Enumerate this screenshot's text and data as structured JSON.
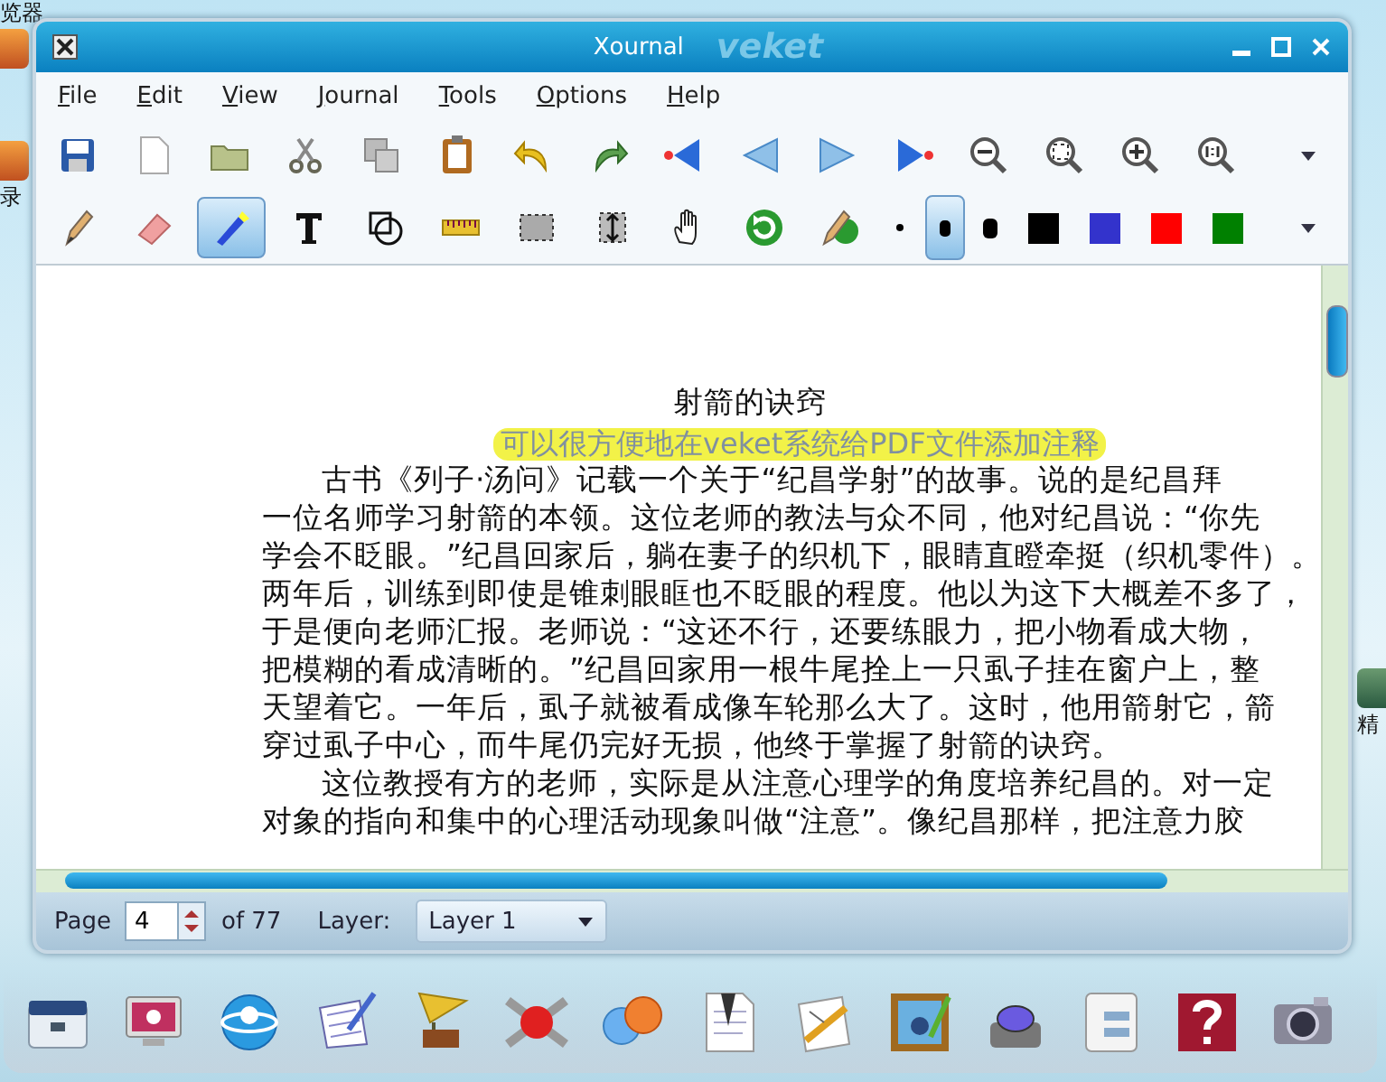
{
  "window": {
    "title": "Xournal",
    "brand": "veket"
  },
  "menu": [
    "File",
    "Edit",
    "View",
    "Journal",
    "Tools",
    "Options",
    "Help"
  ],
  "tools": [
    {
      "kind": "tool",
      "selected": false
    },
    {
      "kind": "tool",
      "selected": false
    },
    {
      "kind": "tool",
      "selected": true
    },
    {
      "kind": "tool",
      "selected": false
    },
    {
      "kind": "tool",
      "selected": false
    },
    {
      "kind": "tool",
      "selected": false
    },
    {
      "kind": "tool",
      "selected": false
    },
    {
      "kind": "tool",
      "selected": false
    },
    {
      "kind": "tool",
      "selected": false
    },
    {
      "kind": "tool",
      "selected": false
    },
    {
      "kind": "tool",
      "selected": false
    },
    {
      "kind": "thickness",
      "selected": false
    },
    {
      "kind": "thickness",
      "selected": true
    },
    {
      "kind": "thickness",
      "selected": false
    },
    {
      "kind": "color",
      "color": "#000000"
    },
    {
      "kind": "color",
      "color": "#3333cc"
    },
    {
      "kind": "color",
      "color": "#ff0000"
    },
    {
      "kind": "color",
      "color": "#008000"
    }
  ],
  "document": {
    "title": "射箭的诀窍",
    "annotation": "可以很方便地在veket系统给PDF文件添加注释",
    "paragraphs": [
      [
        "古书《列子·汤问》记载一个关于“纪昌学射”的故事。说的是纪昌拜",
        "一位名师学习射箭的本领。这位老师的教法与众不同，他对纪昌说：“你先",
        "学会不眨眼。”纪昌回家后，躺在妻子的织机下，眼睛直瞪牵挺（织机零件）。",
        "两年后，训练到即使是锥刺眼眶也不眨眼的程度。他以为这下大概差不多了，",
        "于是便向老师汇报。老师说：“这还不行，还要练眼力，把小物看成大物，",
        "把模糊的看成清晰的。”纪昌回家用一根牛尾拴上一只虱子挂在窗户上，整",
        "天望着它。一年后，虱子就被看成像车轮那么大了。这时，他用箭射它，箭",
        "穿过虱子中心，而牛尾仍完好无损，他终于掌握了射箭的诀窍。"
      ],
      [
        "这位教授有方的老师，实际是从注意心理学的角度培养纪昌的。对一定",
        "对象的指向和集中的心理活动现象叫做“注意”。像纪昌那样，把注意力胶"
      ]
    ]
  },
  "status_bar": {
    "page_label": "Page",
    "page": "4",
    "page_of": "of 77",
    "layer_label": "Layer:",
    "layer": "Layer 1"
  },
  "desktop_left_labels": [
    "览器",
    "录"
  ],
  "desktop_right_labels": [
    "精"
  ]
}
